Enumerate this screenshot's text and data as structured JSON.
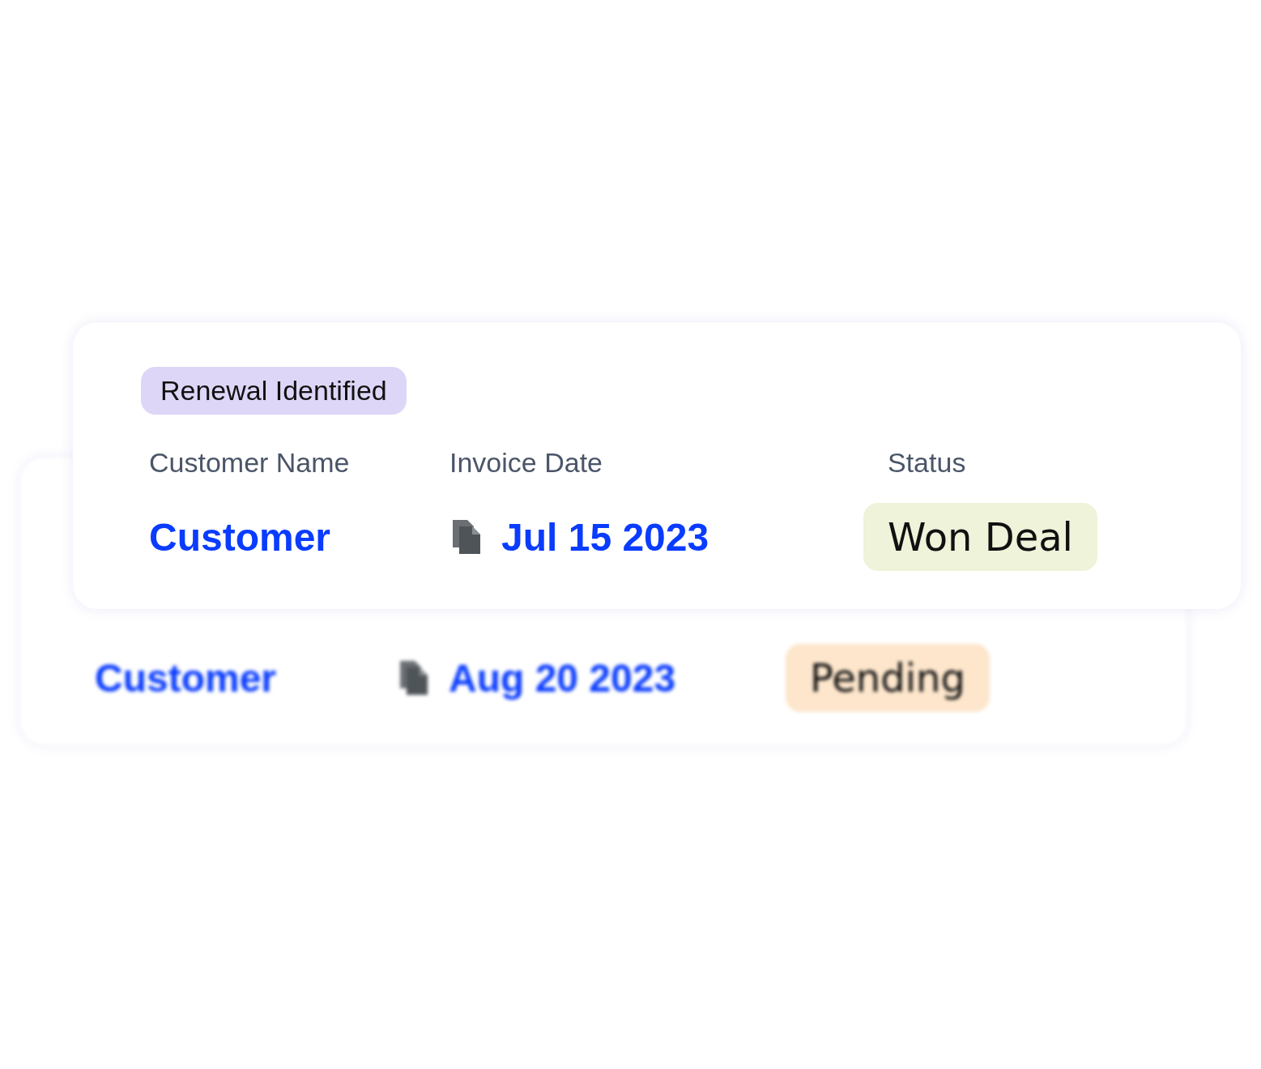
{
  "cards": [
    {
      "kind": "front",
      "tag": "Renewal Identified",
      "columns": [
        "Customer Name",
        "Invoice Date",
        "Status"
      ],
      "customer": "Customer",
      "invoice_date": "Jul 15 2023",
      "status": {
        "label": "Won Deal",
        "color": "#eef3d9"
      }
    },
    {
      "kind": "back",
      "customer": "Customer",
      "invoice_date": "Aug 20 2023",
      "status": {
        "label": "Pending",
        "color": "#fde6cc"
      }
    }
  ]
}
